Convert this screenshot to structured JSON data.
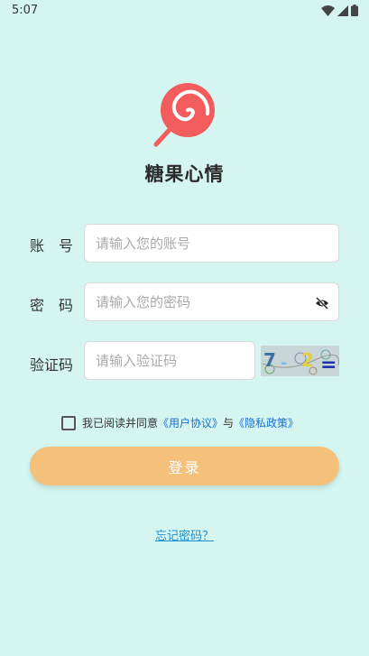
{
  "status_bar": {
    "time": "5:07",
    "icons": [
      "wifi-icon",
      "signal-icon",
      "battery-icon"
    ]
  },
  "app": {
    "name": "糖果心情",
    "logo_icon": "lollipop-icon",
    "logo_color": "#f25c5c"
  },
  "form": {
    "account": {
      "label": "账　号",
      "placeholder": "请输入您的账号",
      "value": ""
    },
    "password": {
      "label": "密　码",
      "placeholder": "请输入您的密码",
      "value": "",
      "toggle_icon": "eye-slash-icon"
    },
    "captcha": {
      "label": "验证码",
      "placeholder": "请输入验证码",
      "value": "",
      "image_text": "7-2="
    }
  },
  "agreement": {
    "checked": false,
    "prefix": "我已阅读并同意",
    "user_agreement": "《用户协议》",
    "and": "与",
    "privacy_policy": "《隐私政策》"
  },
  "login_button": {
    "label": "登录",
    "color": "#f4c07a"
  },
  "forgot_link": {
    "label": "忘记密码？"
  },
  "colors": {
    "background": "#d5f5f1",
    "link": "#1a6fd1"
  }
}
